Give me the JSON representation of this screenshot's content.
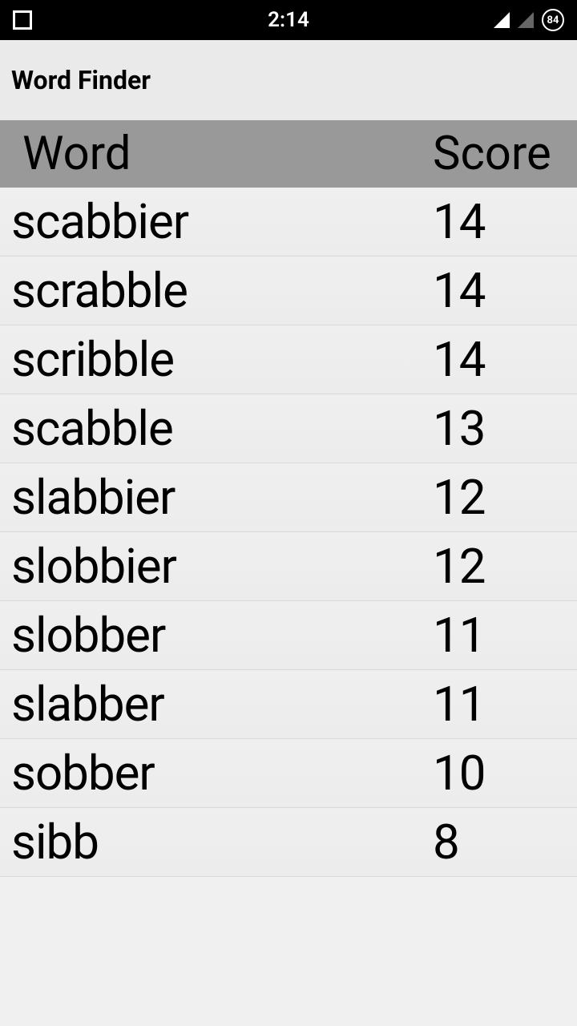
{
  "status_bar": {
    "time": "2:14",
    "battery": "84"
  },
  "app": {
    "title": "Word Finder"
  },
  "table": {
    "header_word": "Word",
    "header_score": "Score"
  },
  "results": [
    {
      "word": "scabbier",
      "score": "14"
    },
    {
      "word": "scrabble",
      "score": "14"
    },
    {
      "word": "scribble",
      "score": "14"
    },
    {
      "word": "scabble",
      "score": "13"
    },
    {
      "word": "slabbier",
      "score": "12"
    },
    {
      "word": "slobbier",
      "score": "12"
    },
    {
      "word": "slobber",
      "score": "11"
    },
    {
      "word": "slabber",
      "score": "11"
    },
    {
      "word": "sobber",
      "score": "10"
    },
    {
      "word": "sibb",
      "score": "8"
    }
  ]
}
